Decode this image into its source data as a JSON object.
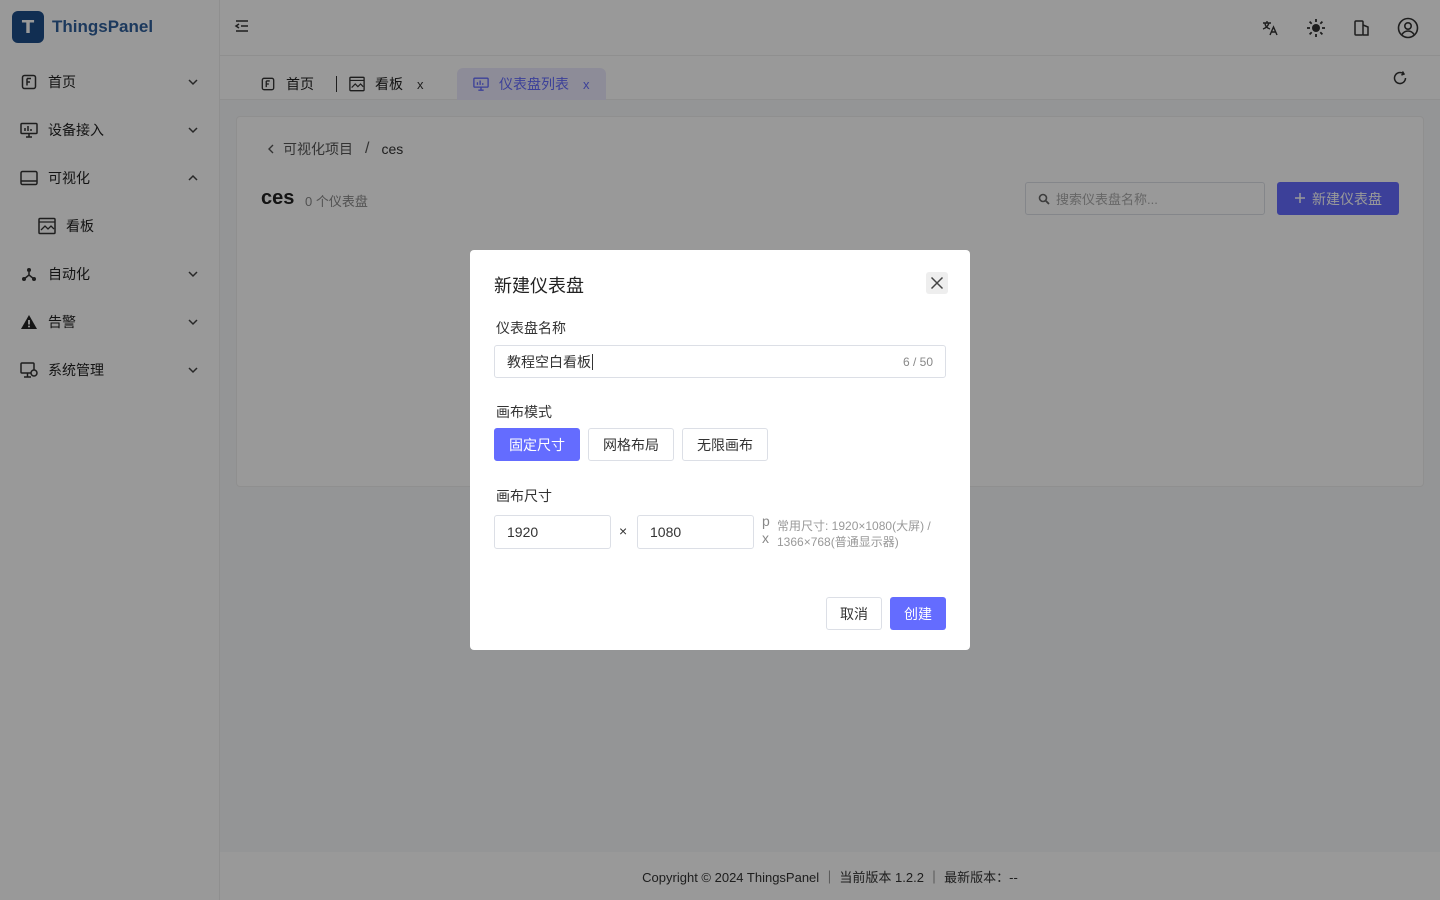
{
  "app": {
    "name": "ThingsPanel",
    "logo_letter": "T"
  },
  "sidebar": {
    "items": [
      {
        "label": "首页",
        "icon": "home-icon",
        "expanded": false
      },
      {
        "label": "设备接入",
        "icon": "device-icon",
        "expanded": false
      },
      {
        "label": "可视化",
        "icon": "visualization-icon",
        "expanded": true
      },
      {
        "label": "看板",
        "icon": "dashboard-icon",
        "sub": true
      },
      {
        "label": "自动化",
        "icon": "automation-icon",
        "expanded": false
      },
      {
        "label": "告警",
        "icon": "alarm-icon",
        "expanded": false
      },
      {
        "label": "系统管理",
        "icon": "system-icon",
        "expanded": false
      }
    ]
  },
  "header": {
    "icons": [
      "translate-icon",
      "theme-icon",
      "layout-icon",
      "user-icon"
    ]
  },
  "tabs": [
    {
      "label": "首页",
      "icon": "home-icon"
    },
    {
      "label": "看板",
      "icon": "dashboard-icon",
      "close": "x"
    },
    {
      "label": "仪表盘列表",
      "icon": "monitor-icon",
      "close": "x",
      "active": true
    }
  ],
  "main": {
    "breadcrumb": {
      "parent": "可视化项目",
      "separator": "/",
      "current": "ces"
    },
    "title": "ces",
    "count": "0 个仪表盘",
    "search_placeholder": "搜索仪表盘名称...",
    "new_button": "新建仪表盘"
  },
  "footer": {
    "text": "Copyright © 2024 ThingsPanel ｜ 当前版本 1.2.2 ｜ 最新版本：--"
  },
  "modal": {
    "title": "新建仪表盘",
    "name_label": "仪表盘名称",
    "name_value": "教程空白看板",
    "name_counter": "6 / 50",
    "mode_label": "画布模式",
    "modes": [
      {
        "label": "固定尺寸",
        "active": true
      },
      {
        "label": "网格布局",
        "active": false
      },
      {
        "label": "无限画布",
        "active": false
      }
    ],
    "size_label": "画布尺寸",
    "width": "1920",
    "height": "1080",
    "times": "×",
    "unit": "px",
    "hint": "常用尺寸: 1920×1080(大屏) / 1366×768(普通显示器)",
    "cancel": "取消",
    "create": "创建"
  },
  "colors": {
    "accent": "#646cff",
    "brand": "#2f5f9b"
  }
}
